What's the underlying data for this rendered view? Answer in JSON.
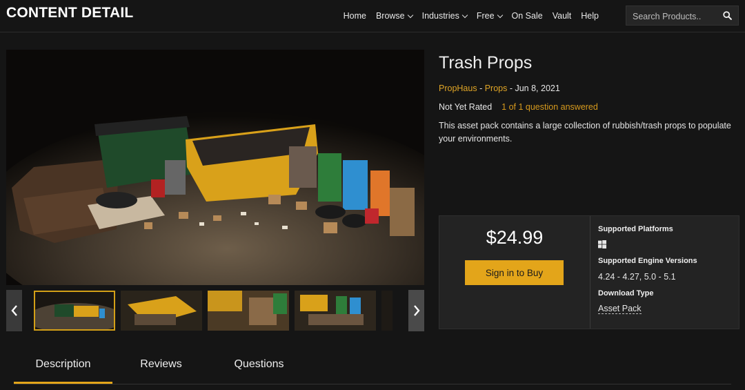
{
  "header": {
    "brand": "CONTENT DETAIL",
    "nav": [
      {
        "label": "Home",
        "dropdown": false
      },
      {
        "label": "Browse",
        "dropdown": true
      },
      {
        "label": "Industries",
        "dropdown": true
      },
      {
        "label": "Free",
        "dropdown": true
      },
      {
        "label": "On Sale",
        "dropdown": false
      },
      {
        "label": "Vault",
        "dropdown": false
      },
      {
        "label": "Help",
        "dropdown": false
      }
    ],
    "search_placeholder": "Search Products..",
    "search_icon": "search-icon"
  },
  "product": {
    "title": "Trash Props",
    "seller": "PropHaus",
    "sep1": " - ",
    "category": "Props",
    "sep2": " - ",
    "date": "Jun 8, 2021",
    "rating": "Not Yet Rated",
    "questions": "1 of 1 question answered",
    "description": "This asset pack contains a large collection of rubbish/trash props to populate your environments."
  },
  "purchase": {
    "price": "$24.99",
    "buy_label": "Sign in to Buy",
    "platforms_label": "Supported Platforms",
    "platform_icon": "windows-icon",
    "engine_label": "Supported Engine Versions",
    "engine_versions": "4.24 - 4.27, 5.0 - 5.1",
    "download_label": "Download Type",
    "download_type": "Asset Pack"
  },
  "gallery": {
    "prev_icon": "chevron-left-icon",
    "next_icon": "chevron-right-icon",
    "thumbnail_count": 5,
    "active_thumbnail": 1
  },
  "tabs": [
    {
      "label": "Description",
      "active": true
    },
    {
      "label": "Reviews",
      "active": false
    },
    {
      "label": "Questions",
      "active": false
    }
  ],
  "colors": {
    "accent": "#e3a51a",
    "link": "#e0a526",
    "background": "#151515",
    "panel": "#232323"
  }
}
